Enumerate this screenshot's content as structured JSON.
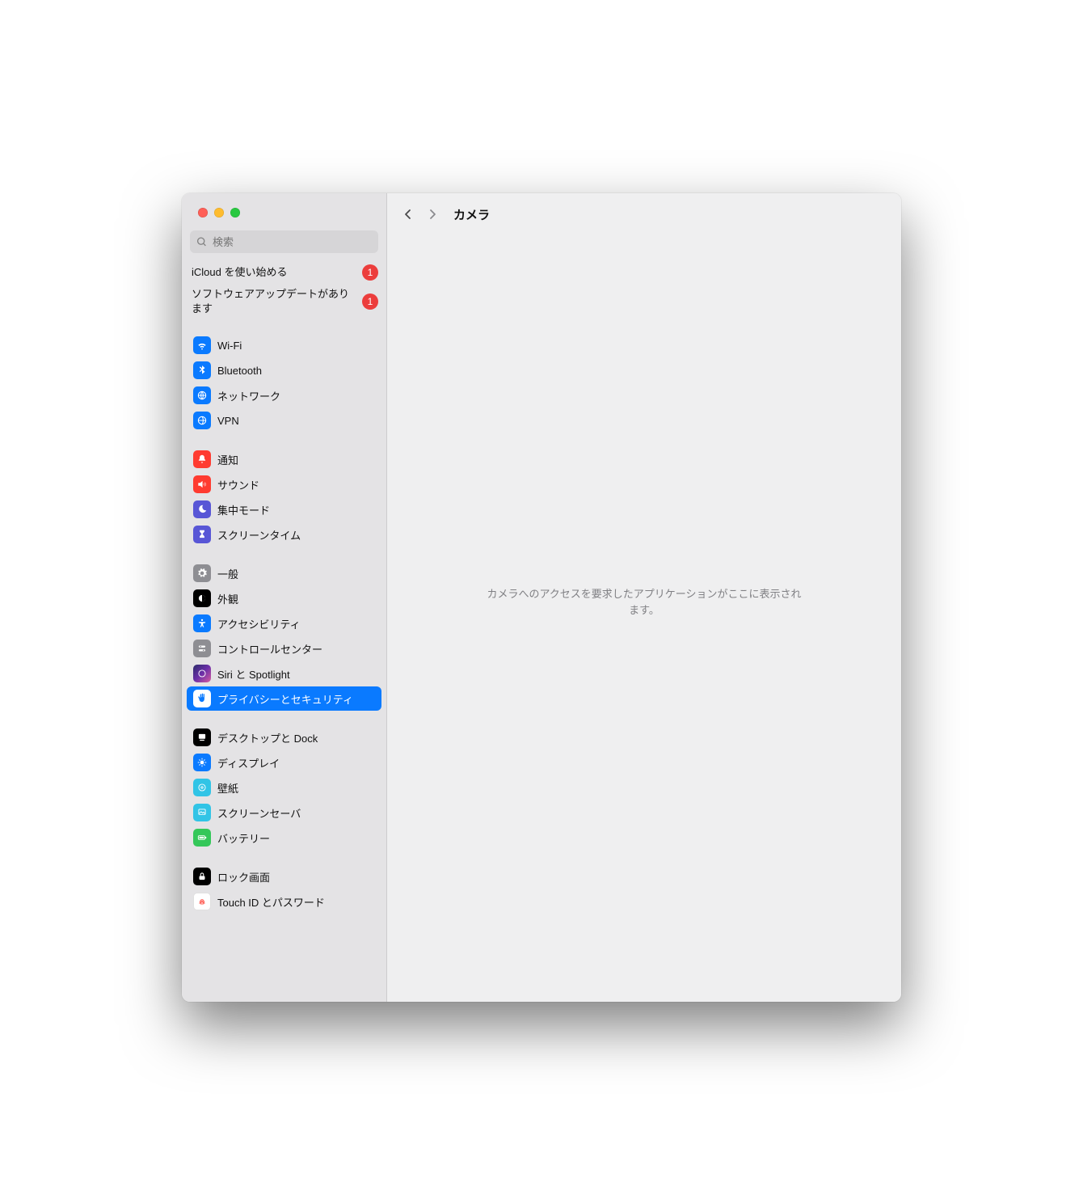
{
  "header": {
    "title": "カメラ"
  },
  "search": {
    "placeholder": "検索"
  },
  "notices": [
    {
      "label": "iCloud を使い始める",
      "badge": "1"
    },
    {
      "label": "ソフトウェアアップデートがあります",
      "badge": "1"
    }
  ],
  "sidebar": {
    "group_net": [
      {
        "label": "Wi-Fi"
      },
      {
        "label": "Bluetooth"
      },
      {
        "label": "ネットワーク"
      },
      {
        "label": "VPN"
      }
    ],
    "group_alerts": [
      {
        "label": "通知"
      },
      {
        "label": "サウンド"
      },
      {
        "label": "集中モード"
      },
      {
        "label": "スクリーンタイム"
      }
    ],
    "group_sys": [
      {
        "label": "一般"
      },
      {
        "label": "外観"
      },
      {
        "label": "アクセシビリティ"
      },
      {
        "label": "コントロールセンター"
      },
      {
        "label": "Siri と Spotlight"
      },
      {
        "label": "プライバシーとセキュリティ",
        "selected": true
      }
    ],
    "group_disp": [
      {
        "label": "デスクトップと Dock"
      },
      {
        "label": "ディスプレイ"
      },
      {
        "label": "壁紙"
      },
      {
        "label": "スクリーンセーバ"
      },
      {
        "label": "バッテリー"
      }
    ],
    "group_sec": [
      {
        "label": "ロック画面"
      },
      {
        "label": "Touch ID とパスワード"
      }
    ]
  },
  "main": {
    "empty_message": "カメラへのアクセスを要求したアプリケーションがここに表示されます。"
  }
}
